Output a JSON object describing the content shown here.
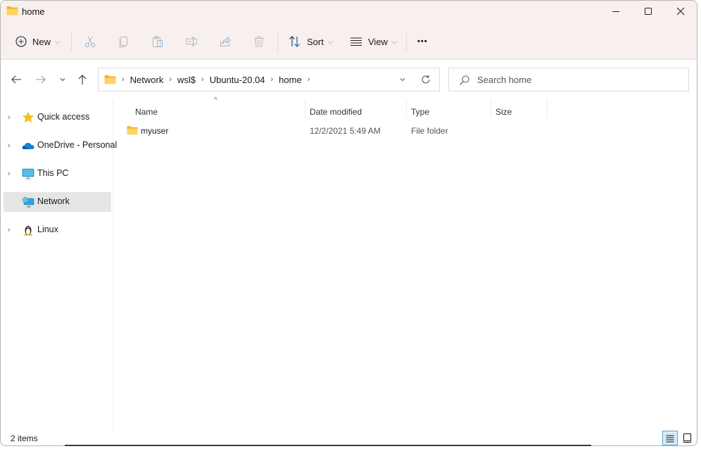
{
  "window": {
    "title": "home",
    "controls": {
      "minimize": "minimize",
      "maximize": "maximize",
      "close": "close"
    }
  },
  "toolbar": {
    "new_label": "New",
    "sort_label": "Sort",
    "view_label": "View",
    "more_label": "•••",
    "icons": [
      "cut-icon",
      "copy-icon",
      "paste-icon",
      "rename-icon",
      "share-icon",
      "delete-icon"
    ]
  },
  "navigation": {
    "breadcrumb": [
      "Network",
      "wsl$",
      "Ubuntu-20.04",
      "home"
    ],
    "search_placeholder": "Search home"
  },
  "sidebar": {
    "items": [
      {
        "label": "Quick access",
        "icon": "star-icon",
        "expandable": true,
        "selected": false
      },
      {
        "label": "OneDrive - Personal",
        "icon": "cloud-icon",
        "expandable": true,
        "selected": false
      },
      {
        "label": "This PC",
        "icon": "monitor-icon",
        "expandable": true,
        "selected": false
      },
      {
        "label": "Network",
        "icon": "network-icon",
        "expandable": false,
        "selected": true
      },
      {
        "label": "Linux",
        "icon": "linux-penguin-icon",
        "expandable": true,
        "selected": false
      }
    ]
  },
  "file_list": {
    "columns": [
      "Name",
      "Date modified",
      "Type",
      "Size"
    ],
    "sort_column": "Name",
    "rows": [
      {
        "name": "myuser",
        "date_modified": "12/2/2021 5:49 AM",
        "type": "File folder",
        "size": ""
      }
    ]
  },
  "status": {
    "item_count": "2 items",
    "active_view": "details"
  },
  "colors": {
    "accent": "#0067c0",
    "folder": "#f7c948",
    "selection": "#e5e5e5",
    "view_active_border": "#5aa7d1"
  }
}
